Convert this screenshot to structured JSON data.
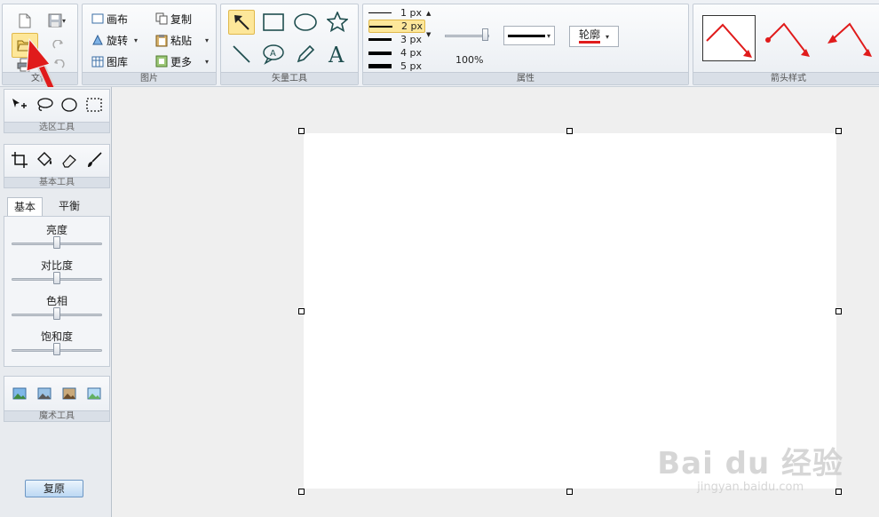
{
  "ribbon": {
    "groups": {
      "file": "文件",
      "image": "图片",
      "vector": "矢量工具",
      "props": "属性",
      "styles": "箭头样式"
    },
    "image": {
      "canvas": "画布",
      "copy": "复制",
      "rotate": "旋转",
      "paste": "粘贴",
      "gallery": "图库",
      "more": "更多"
    },
    "line_widths": [
      "1 px",
      "2 px",
      "3 px",
      "4 px",
      "5 px"
    ],
    "selected_line_width": "2 px",
    "opacity": "100%",
    "outline": "轮廓"
  },
  "left": {
    "selection_label": "选区工具",
    "basic_label": "基本工具",
    "tabs": [
      "基本",
      "平衡"
    ],
    "adjust": [
      "亮度",
      "对比度",
      "色相",
      "饱和度"
    ],
    "adjust_values": [
      0.5,
      0.5,
      0.5,
      0.5
    ],
    "magic_label": "魔术工具",
    "reset": "复原"
  },
  "watermark": {
    "main": "Bai du 经验",
    "sub": "jingyan.baidu.com"
  },
  "colors": {
    "accent_arrow": "#e01b1b",
    "selected_bg": "#fde79a"
  }
}
